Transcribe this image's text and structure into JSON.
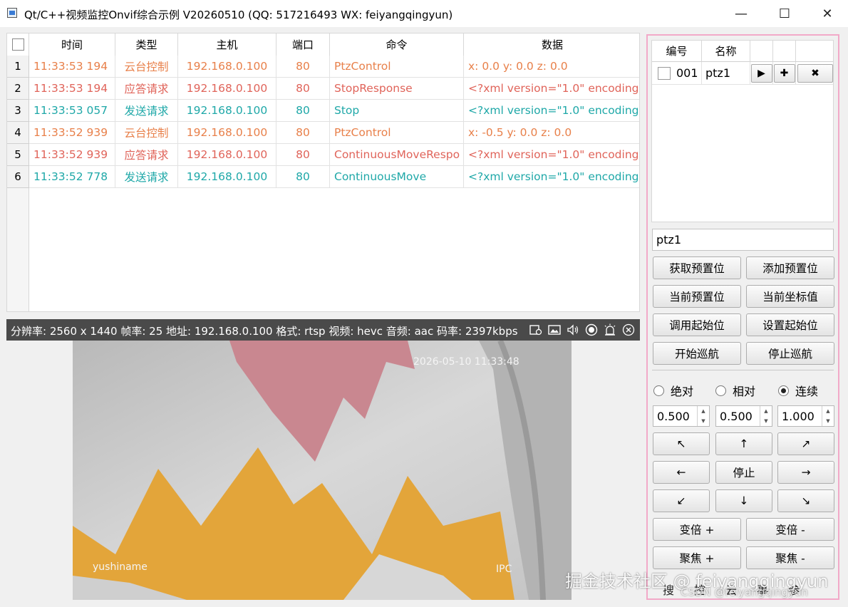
{
  "window": {
    "title": "Qt/C++视频监控Onvif综合示例 V20260510 (QQ: 517216493 WX: feiyangqingyun)",
    "minimize": "—",
    "maximize": "☐",
    "close": "✕"
  },
  "log_table": {
    "headers": [
      "时间",
      "类型",
      "主机",
      "端口",
      "命令",
      "数据"
    ],
    "rows": [
      {
        "no": "1",
        "time": "11:33:53 194",
        "type": "云台控制",
        "host": "192.168.0.100",
        "port": "80",
        "cmd": "PtzControl",
        "data": "x: 0.0  y: 0.0  z: 0.0",
        "color": "#e8804a"
      },
      {
        "no": "2",
        "time": "11:33:53 194",
        "type": "应答请求",
        "host": "192.168.0.100",
        "port": "80",
        "cmd": "StopResponse",
        "data": "<?xml version=\"1.0\" encoding=\"",
        "color": "#e0645a"
      },
      {
        "no": "3",
        "time": "11:33:53 057",
        "type": "发送请求",
        "host": "192.168.0.100",
        "port": "80",
        "cmd": "Stop",
        "data": "<?xml version=\"1.0\" encoding=\"",
        "color": "#1fa8a8"
      },
      {
        "no": "4",
        "time": "11:33:52 939",
        "type": "云台控制",
        "host": "192.168.0.100",
        "port": "80",
        "cmd": "PtzControl",
        "data": "x: -0.5  y: 0.0  z: 0.0",
        "color": "#e8804a"
      },
      {
        "no": "5",
        "time": "11:33:52 939",
        "type": "应答请求",
        "host": "192.168.0.100",
        "port": "80",
        "cmd": "ContinuousMoveRespo",
        "data": "<?xml version=\"1.0\" encoding=\"",
        "color": "#e0645a"
      },
      {
        "no": "6",
        "time": "11:33:52 778",
        "type": "发送请求",
        "host": "192.168.0.100",
        "port": "80",
        "cmd": "ContinuousMove",
        "data": "<?xml version=\"1.0\" encoding=\"",
        "color": "#1fa8a8"
      }
    ]
  },
  "video": {
    "info": "分辨率: 2560 x 1440  帧率: 25  地址: 192.168.0.100  格式: rtsp  视频: hevc  音频: aac  码率: 2397kbps",
    "toolbar_icons": [
      "record-icon",
      "snapshot-icon",
      "sound-icon",
      "target-icon",
      "alarm-icon",
      "close-circle-icon"
    ],
    "osd_time": "2026-05-10 11:33:48",
    "osd_name": "yushiname",
    "osd_ipc": "IPC"
  },
  "presets": {
    "headers": [
      "编号",
      "名称",
      "",
      "",
      ""
    ],
    "rows": [
      {
        "id": "001",
        "name": "ptz1",
        "play": "▶",
        "add": "✚",
        "remove": "✖"
      }
    ],
    "name_value": "ptz1"
  },
  "preset_buttons": {
    "get": "获取预置位",
    "add": "添加预置位",
    "current": "当前预置位",
    "coords": "当前坐标值",
    "call_home": "调用起始位",
    "set_home": "设置起始位",
    "start_tour": "开始巡航",
    "stop_tour": "停止巡航"
  },
  "move_mode": {
    "options": [
      "绝对",
      "相对",
      "连续"
    ],
    "selected": "连续"
  },
  "speeds": [
    "0.500",
    "0.500",
    "1.000"
  ],
  "ptz": {
    "up_left": "↖",
    "up": "↑",
    "up_right": "↗",
    "left": "←",
    "stop": "停止",
    "right": "→",
    "down_left": "↙",
    "down": "↓",
    "down_right": "↘"
  },
  "lens": {
    "zoom_in": "变倍 +",
    "zoom_out": "变倍 -",
    "focus_in": "聚焦 +",
    "focus_out": "聚焦 -"
  },
  "bottom_partial": [
    "搜",
    "控",
    "云",
    "事",
    "参"
  ],
  "watermark": "掘金技术社区 @ feiyangqingyun",
  "watermark2": "CSDN @feiyangqingyun"
}
